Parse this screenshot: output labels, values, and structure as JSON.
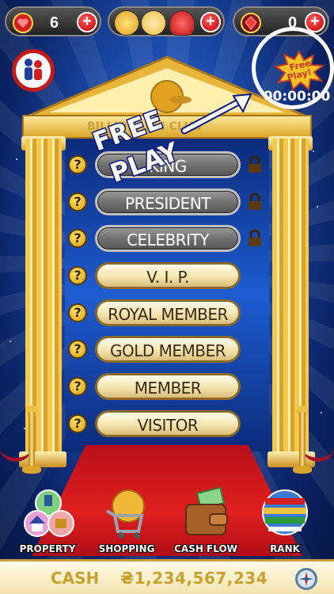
{
  "topbar": {
    "hearts_count": "6",
    "gems_count": "0"
  },
  "free_play_badge": {
    "label_line1": "Free",
    "label_line2": "Play!",
    "timer": "00:00:00"
  },
  "temple": {
    "club_name": "BILLIONAIRE CLUB"
  },
  "overlay": {
    "line1": "FREE",
    "line2": "PLAY"
  },
  "ranks": [
    {
      "label": "KING",
      "locked": true
    },
    {
      "label": "PRESIDENT",
      "locked": true
    },
    {
      "label": "CELEBRITY",
      "locked": true
    },
    {
      "label": "V. I. P.",
      "locked": false
    },
    {
      "label": "ROYAL MEMBER",
      "locked": false
    },
    {
      "label": "GOLD MEMBER",
      "locked": false
    },
    {
      "label": "MEMBER",
      "locked": false
    },
    {
      "label": "VISITOR",
      "locked": false
    }
  ],
  "nav": {
    "property": "PROPERTY",
    "shopping": "SHOPPING",
    "cash_flow": "CASH FLOW",
    "rank": "RANK"
  },
  "cashbar": {
    "label": "CASH",
    "value": "₴1,234,567,234"
  },
  "colors": {
    "accent_red": "#d21f1f",
    "gold": "#f0c040",
    "background_blue": "#1e4fb0"
  }
}
